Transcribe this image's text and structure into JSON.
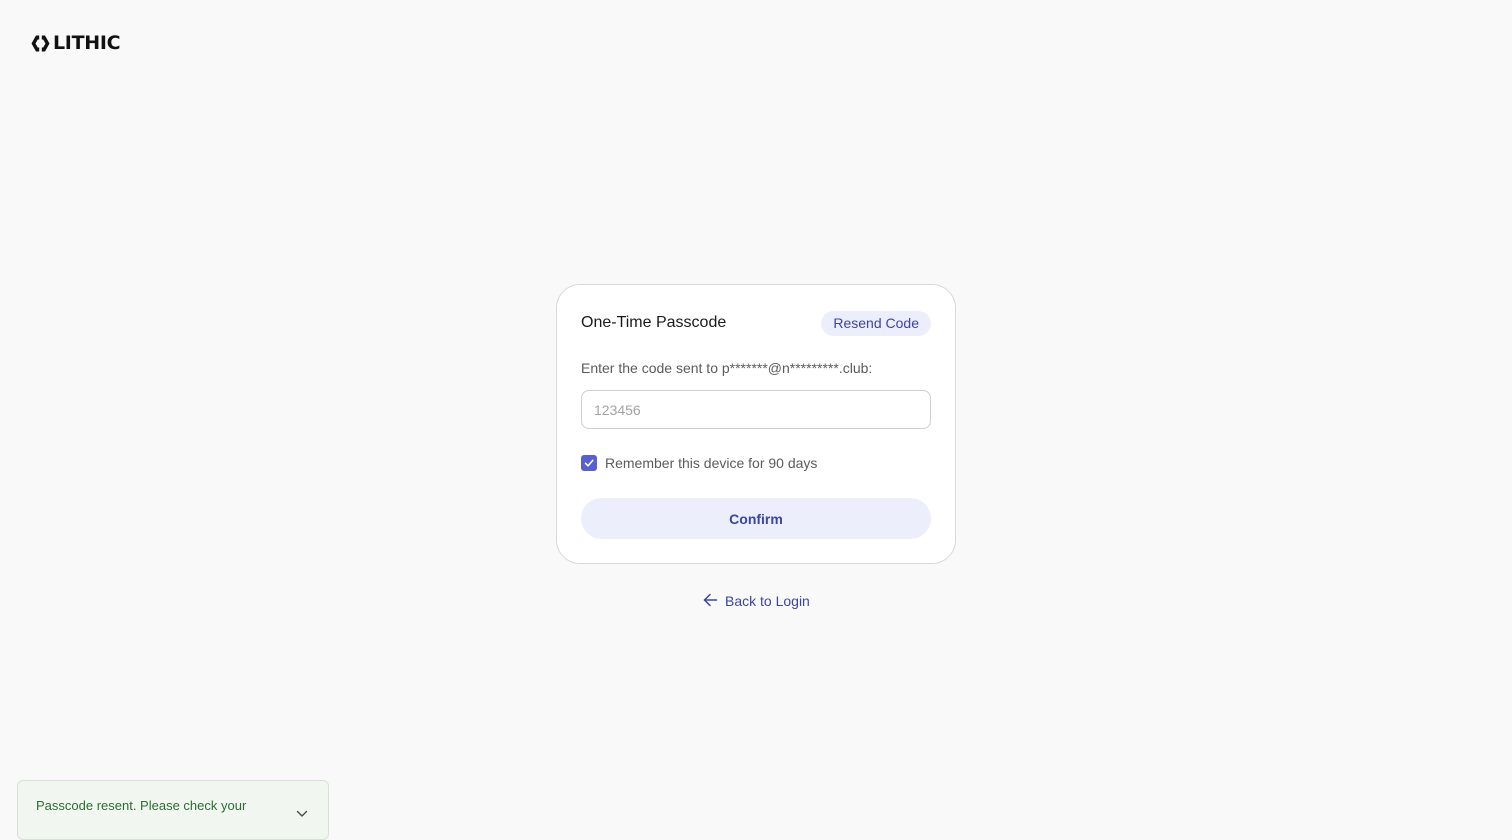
{
  "brand": {
    "name": "LITHIC",
    "logo_icon": "lithic-mark-icon"
  },
  "card": {
    "title": "One-Time Passcode",
    "resend_label": "Resend Code",
    "prompt": "Enter the code sent to p*******@n*********.club:",
    "code_input": {
      "value": "",
      "placeholder": "123456"
    },
    "remember": {
      "checked": true,
      "label": "Remember this device for 90 days"
    },
    "confirm_label": "Confirm"
  },
  "back_link": {
    "label": "Back to Login",
    "icon": "arrow-left-icon"
  },
  "toast": {
    "message": "Passcode resent. Please check your",
    "icon": "chevron-down-icon"
  },
  "colors": {
    "background": "#f9f9f9",
    "accent": "#3b45a3",
    "accent_soft": "#eceefb",
    "checkbox": "#5660d0",
    "success_text": "#2a6e2f"
  }
}
